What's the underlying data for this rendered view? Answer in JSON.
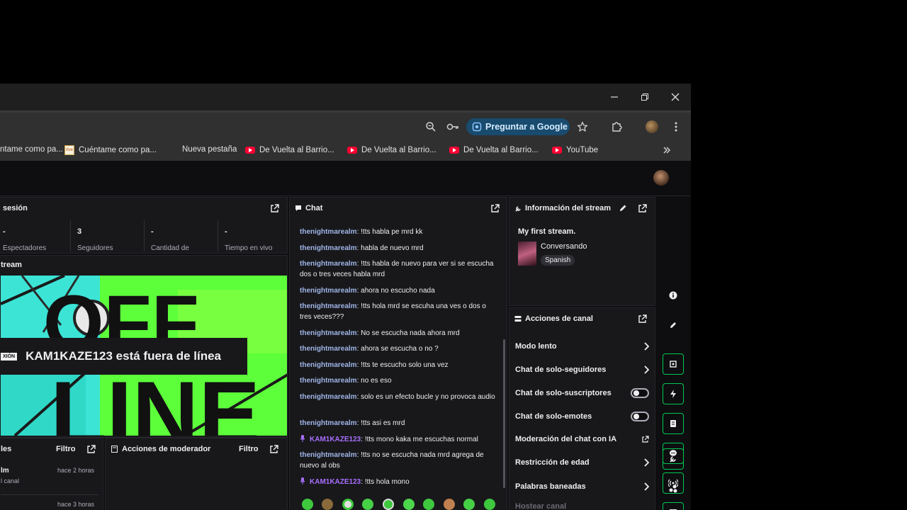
{
  "browser": {
    "toolbar": {
      "ask_google": "Preguntar a Google"
    },
    "bookmarks": [
      {
        "label": "ntame como pa...",
        "icon": "none"
      },
      {
        "label": "Cuéntame como pa...",
        "icon": "document-favicon"
      },
      {
        "label": "Nueva pestaña",
        "icon": "none"
      },
      {
        "label": "De Vuelta al Barrio...",
        "icon": "youtube-icon"
      },
      {
        "label": "De Vuelta al Barrio...",
        "icon": "youtube-icon"
      },
      {
        "label": "De Vuelta al Barrio...",
        "icon": "youtube-icon"
      },
      {
        "label": "YouTube",
        "icon": "youtube-icon"
      }
    ]
  },
  "session": {
    "title": "sesión",
    "stats": [
      {
        "value": "-",
        "label": "Espectadores"
      },
      {
        "value": "3",
        "label": "Seguidores"
      },
      {
        "value": "-",
        "label": "Cantidad de"
      },
      {
        "value": "-",
        "label": "Tiempo en vivo"
      }
    ]
  },
  "preview": {
    "title": "tream",
    "badge": "XIÓN",
    "offline_text": "KAM1KAZE123 está fuera de línea",
    "art_text_top": "OFF",
    "art_text_bottom": "LINE"
  },
  "activity": {
    "title": "les",
    "filter": "Filtro",
    "items": [
      {
        "name": "lm",
        "sub": "l canal",
        "time": "hace 2 horas"
      },
      {
        "name": "",
        "sub": "",
        "time": "hace 3 horas"
      }
    ]
  },
  "mod_actions": {
    "title": "Acciones de moderador",
    "filter": "Filtro"
  },
  "chat": {
    "title": "Chat",
    "messages": [
      {
        "user": "thenightmarealm",
        "text": "!tts habla pe mrd kk",
        "broadcaster": false
      },
      {
        "user": "thenightmarealm",
        "text": "habla de nuevo mrd",
        "broadcaster": false
      },
      {
        "user": "thenightmarealm",
        "text": "!tts habla de nuevo para ver si se escucha dos o tres veces habla mrd",
        "broadcaster": false
      },
      {
        "user": "thenightmarealm",
        "text": "ahora no escucho nada",
        "broadcaster": false
      },
      {
        "user": "thenightmarealm",
        "text": "!tts hola mrd se escuha una ves o dos o tres veces???",
        "broadcaster": false
      },
      {
        "user": "thenightmarealm",
        "text": "No se escucha nada ahora mrd",
        "broadcaster": false
      },
      {
        "user": "thenightmarealm",
        "text": "ahora se escucha o no ?",
        "broadcaster": false
      },
      {
        "user": "thenightmarealm",
        "text": "!tts te escucho solo una vez",
        "broadcaster": false
      },
      {
        "user": "thenightmarealm",
        "text": "no es eso",
        "broadcaster": false
      },
      {
        "user": "thenightmarealm",
        "text": "solo es un efecto bucle y no provoca audio",
        "broadcaster": false
      },
      {
        "user": "thenightmarealm",
        "text": "!tts asi es mrd",
        "broadcaster": false
      },
      {
        "user": "KAM1KAZE123",
        "text": "!tts mono kaka me escuchas normal",
        "broadcaster": true
      },
      {
        "user": "thenightmarealm",
        "text": "!tts no se escucha nada mrd agrega de nuevo al obs",
        "broadcaster": false
      },
      {
        "user": "KAM1KAZE123",
        "text": "!tts hola mono",
        "broadcaster": true
      }
    ],
    "separator": ": "
  },
  "stream_info": {
    "title": "Información del stream",
    "stream_title": "My first stream.",
    "category": "Conversando",
    "tag": "Spanish"
  },
  "channel_actions": {
    "title": "Acciones de canal",
    "rows": [
      {
        "label": "Modo lento",
        "control": "chevron"
      },
      {
        "label": "Chat de solo-seguidores",
        "control": "chevron"
      },
      {
        "label": "Chat de solo-suscriptores",
        "control": "toggle"
      },
      {
        "label": "Chat de solo-emotes",
        "control": "toggle"
      },
      {
        "label": "Moderación del chat con IA",
        "control": "external"
      },
      {
        "label": "Restricción de edad",
        "control": "chevron"
      },
      {
        "label": "Palabras baneadas",
        "control": "chevron"
      },
      {
        "label": "Hostear canal",
        "control": "none"
      }
    ]
  },
  "colors": {
    "accent_green": "#00c853",
    "username_blue": "#9fb4e6",
    "broadcaster_purple": "#a970ff",
    "panel_bg": "#18181b"
  }
}
